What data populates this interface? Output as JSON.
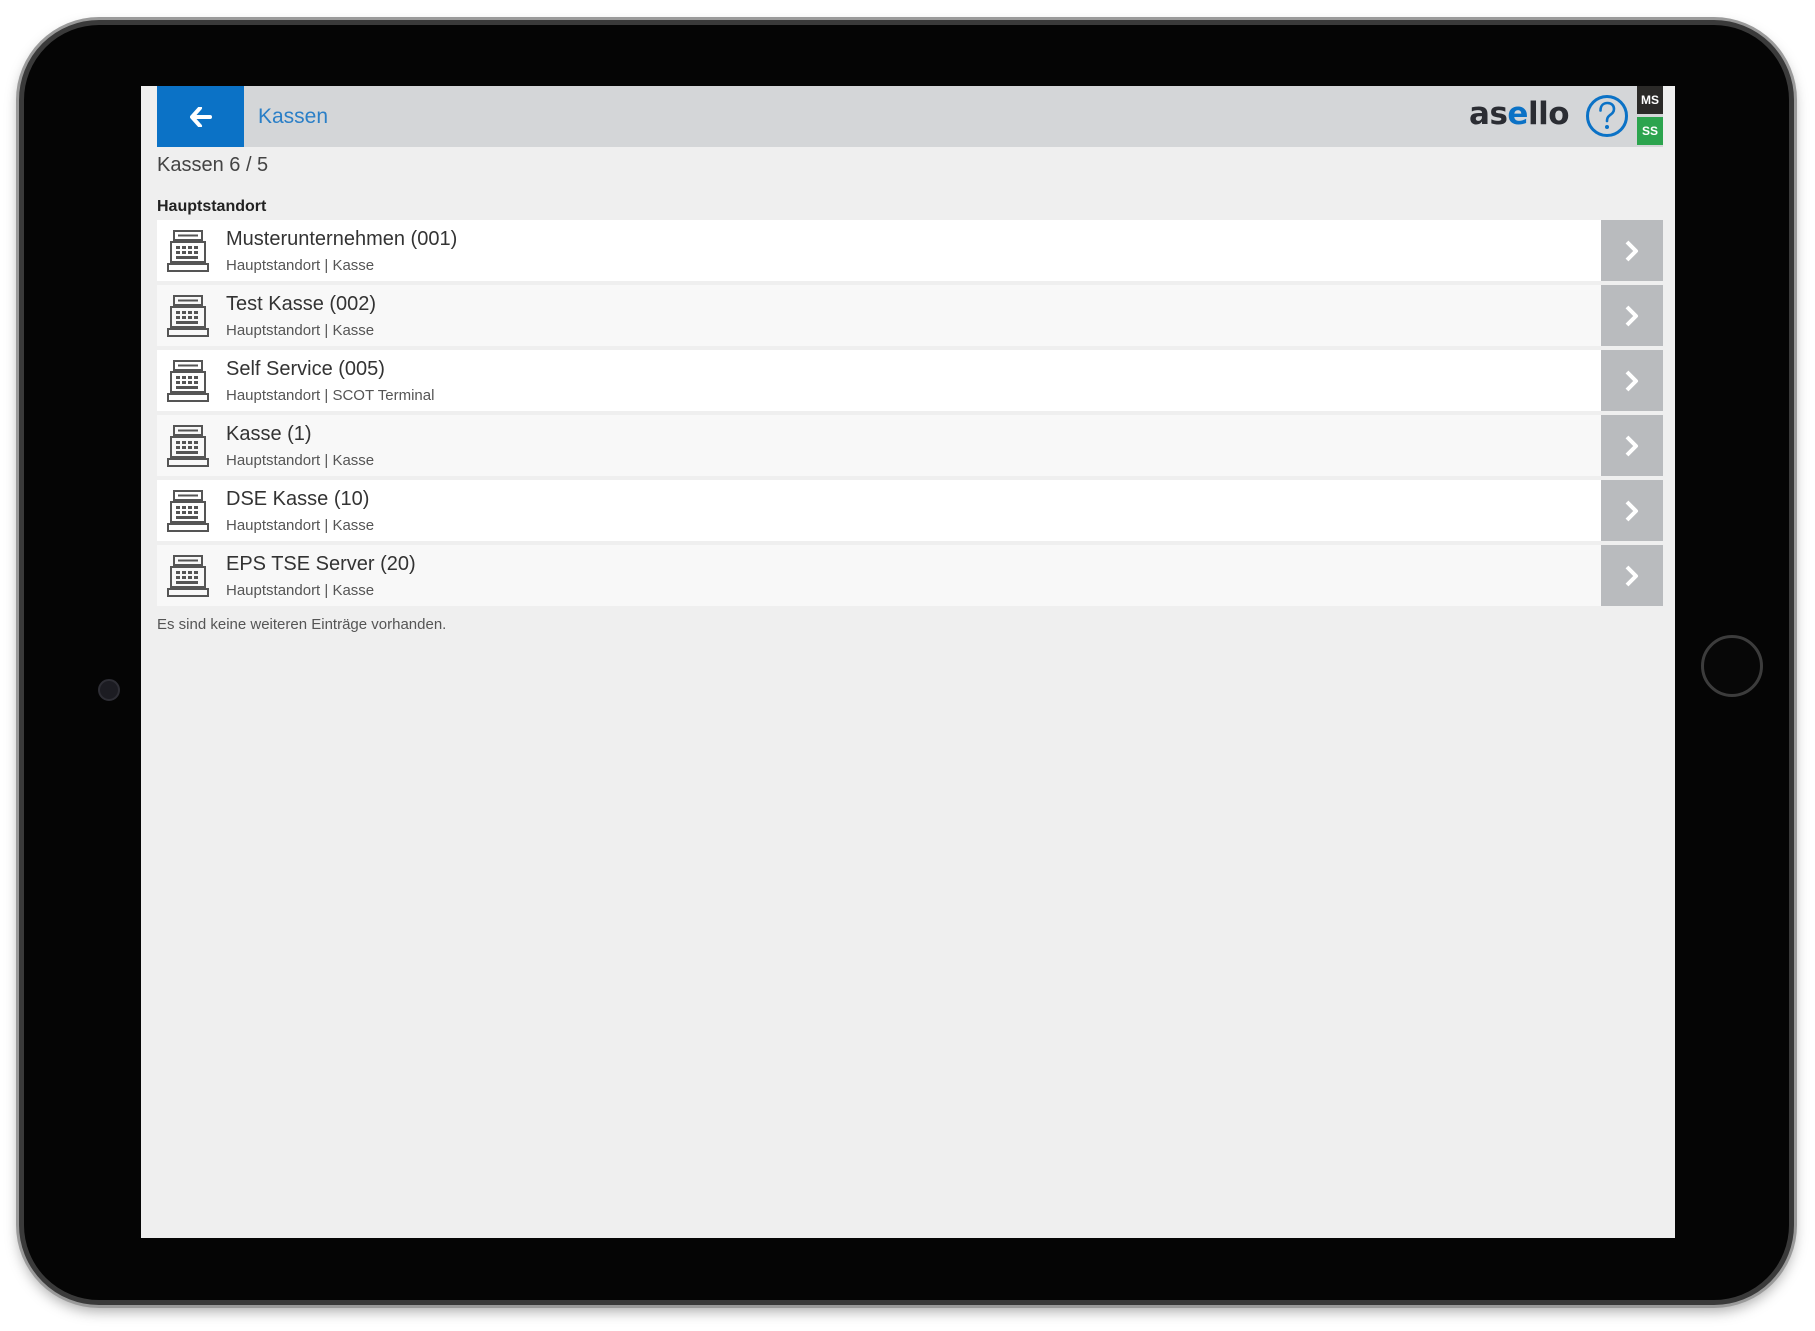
{
  "header": {
    "title": "Kassen",
    "logo_prefix": "as",
    "logo_accent": "e",
    "logo_suffix": "llo",
    "badges": [
      "MS",
      "SS"
    ],
    "colors": {
      "primary": "#0b72c6",
      "badge_ms": "#2b2a28",
      "badge_ss": "#2ca44e"
    }
  },
  "summary": {
    "count_label": "Kassen 6 / 5"
  },
  "group": {
    "title": "Hauptstandort"
  },
  "items": [
    {
      "title": "Musterunternehmen (001)",
      "subtitle": "Hauptstandort | Kasse",
      "icon": "cash-register-icon"
    },
    {
      "title": "Test Kasse (002)",
      "subtitle": "Hauptstandort | Kasse",
      "icon": "cash-register-icon"
    },
    {
      "title": "Self Service (005)",
      "subtitle": "Hauptstandort | SCOT Terminal",
      "icon": "cash-register-icon"
    },
    {
      "title": "Kasse (1)",
      "subtitle": "Hauptstandort | Kasse",
      "icon": "cash-register-icon"
    },
    {
      "title": "DSE Kasse (10)",
      "subtitle": "Hauptstandort | Kasse",
      "icon": "cash-register-icon"
    },
    {
      "title": "EPS TSE Server (20)",
      "subtitle": "Hauptstandort | Kasse",
      "icon": "cash-register-icon"
    }
  ],
  "footer": {
    "empty_text": "Es sind keine weiteren Einträge vorhanden."
  }
}
